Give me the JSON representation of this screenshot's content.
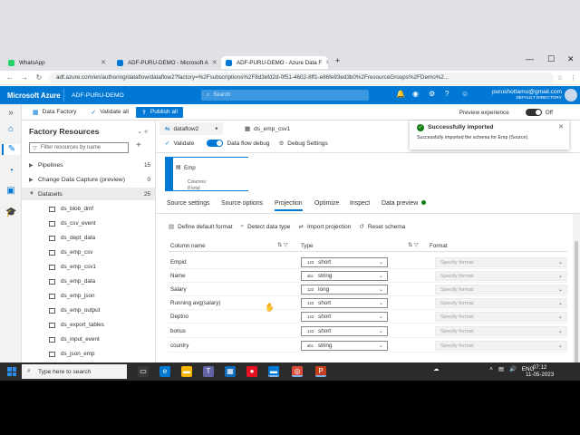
{
  "browser": {
    "tabs": [
      {
        "label": "WhatsApp",
        "color": "#25d366"
      },
      {
        "label": "ADF-PURU-DEMO - Microsoft A",
        "color": "#0078d4"
      },
      {
        "label": "ADF-PURU-DEMO - Azure Data F",
        "color": "#0078d4"
      }
    ],
    "new_tab": "+",
    "url": "adf.azure.com/en/authoring/dataflow/dataflow2?factory=%2Fsubscriptions%2F8d3efd2d-0f51-4602-8ff1-e86fe93ed3b0%2FresourceGroups%2FDemo%2..."
  },
  "azure": {
    "brand": "Microsoft Azure",
    "factory": "ADF-PURU-DEMO",
    "search_placeholder": "Search",
    "notification_count": "1",
    "user": "purushottamu@gmail.com",
    "directory": "DEFAULT DIRECTORY"
  },
  "toolbar": {
    "data_factory": "Data Factory",
    "validate_all": "Validate all",
    "publish_all": "Publish all",
    "publish_count": "1",
    "preview_experience": "Preview experience",
    "preview_state": "Off"
  },
  "resources": {
    "title": "Factory Resources",
    "filter_placeholder": "Filter resources by name",
    "groups": [
      {
        "label": "Pipelines",
        "count": "15"
      },
      {
        "label": "Change Data Capture (preview)",
        "count": "0"
      },
      {
        "label": "Datasets",
        "count": "25"
      }
    ],
    "datasets": [
      "ds_blob_dmf",
      "ds_csv_event",
      "ds_dept_data",
      "ds_emp_csv",
      "ds_emp_csv1",
      "ds_emp_data",
      "ds_emp_json",
      "ds_emp_output",
      "ds_export_tables",
      "ds_input_event",
      "ds_json_emp"
    ]
  },
  "editor": {
    "tabs": [
      "dataflow2",
      "ds_emp_csv1"
    ],
    "validate": "Validate",
    "data_flow_debug": "Data flow debug",
    "debug_settings": "Debug Settings",
    "node_name": "Emp",
    "node_columns_label": "Columns:",
    "node_columns_value": "8 total"
  },
  "panel": {
    "tabs": [
      "Source settings",
      "Source options",
      "Projection",
      "Optimize",
      "Inspect",
      "Data preview"
    ],
    "active_tab": "Projection",
    "actions": [
      "Define default format",
      "Detect data type",
      "Import projection",
      "Reset schema"
    ],
    "headers": {
      "column": "Column name",
      "type": "Type",
      "format": "Format"
    },
    "format_placeholder": "Specify format",
    "rows": [
      {
        "name": "Empid",
        "type": "short",
        "type_icon": "123"
      },
      {
        "name": "Name",
        "type": "string",
        "type_icon": "abc"
      },
      {
        "name": "Salary",
        "type": "long",
        "type_icon": "123"
      },
      {
        "name": "Running avg(salary)",
        "type": "short",
        "type_icon": "123"
      },
      {
        "name": "Deptno",
        "type": "short",
        "type_icon": "123"
      },
      {
        "name": "bonus",
        "type": "short",
        "type_icon": "123"
      },
      {
        "name": "country",
        "type": "string",
        "type_icon": "abc"
      }
    ]
  },
  "toast": {
    "title": "Successfully imported",
    "message": "Successfully imported the schema for Emp (Source)."
  },
  "taskbar": {
    "search_placeholder": "Type here to search",
    "weather": "☁",
    "lang": "ENG",
    "time": "07:12",
    "date": "11-05-2023"
  }
}
